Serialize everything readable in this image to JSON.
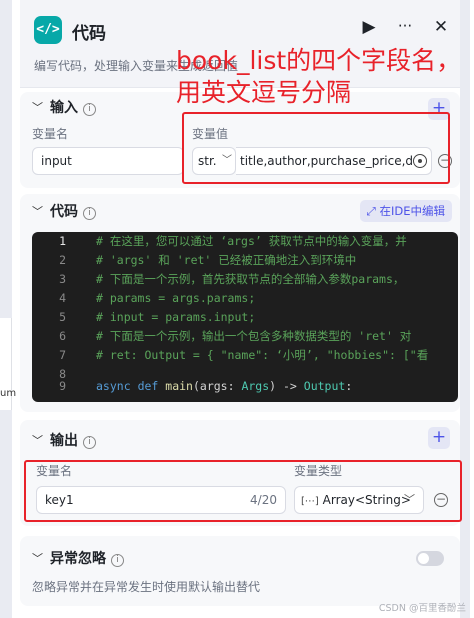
{
  "node": {
    "title": "代码",
    "subtitle": "编写代码，处理输入变量来生成返回值",
    "icon": "code-brackets-icon",
    "actions": {
      "run": "▶",
      "more": "···",
      "close": "✕"
    }
  },
  "input": {
    "title": "输入",
    "name_header": "变量名",
    "value_header": "变量值",
    "name_value": "input",
    "type_value": "str.",
    "value_text": "title,author,purchase_price,de"
  },
  "code": {
    "title": "代码",
    "ide_button": "在IDE中编辑",
    "lines": [
      {
        "n": "1",
        "text": "# 在这里，您可以通过 ‘args’  获取节点中的输入变量，并"
      },
      {
        "n": "2",
        "text": "# 'args' 和 'ret' 已经被正确地注入到环境中"
      },
      {
        "n": "3",
        "text": "# 下面是一个示例，首先获取节点的全部输入参数params，"
      },
      {
        "n": "4",
        "text": "# params = args.params;"
      },
      {
        "n": "5",
        "text": "# input = params.input;"
      },
      {
        "n": "6",
        "text": "# 下面是一个示例，输出一个包含多种数据类型的 'ret' 对"
      },
      {
        "n": "7",
        "text": "# ret: Output =  { \"name\": ‘小明’, \"hobbies\": [\"看"
      },
      {
        "n": "8",
        "text": ""
      }
    ],
    "line9": {
      "n": "9",
      "async": "async",
      "def": "def",
      "fn": "main",
      "args": "(args: ",
      "argtype": "Args",
      "arrow": ") -> ",
      "ret": "Output",
      "colon": ":"
    }
  },
  "output": {
    "title": "输出",
    "name_header": "变量名",
    "type_header": "变量类型",
    "name_value": "key1",
    "char_count": "4/20",
    "type_value": "Array<String>"
  },
  "exception": {
    "title": "异常忽略",
    "description": "忽略异常并在异常发生时使用默认输出替代",
    "enabled": false
  },
  "annotation": {
    "line1": "book_list的四个字段名，",
    "line2": "用英文逗号分隔",
    "color": "#e8222a"
  },
  "left_fragment": "um",
  "watermark": "CSDN @百里香酚兰",
  "colors": {
    "accent": "#4d53e8",
    "icon_bg": "#07a8a8",
    "code_bg": "#1e1e1e"
  }
}
